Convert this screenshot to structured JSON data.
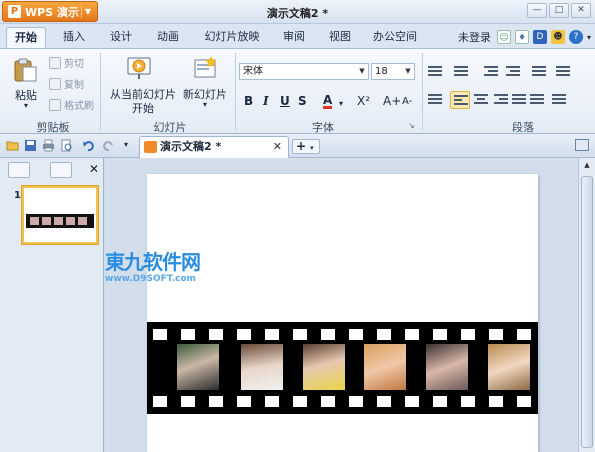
{
  "app": {
    "button_label": "WPS 演示",
    "logo_glyph": "P"
  },
  "window": {
    "title": "演示文稿2 *"
  },
  "menu": {
    "tabs": [
      "开始",
      "插入",
      "设计",
      "动画",
      "幻灯片放映",
      "审阅",
      "视图",
      "办公空间"
    ],
    "active": "开始",
    "login_label": "未登录"
  },
  "ribbon": {
    "clipboard": {
      "paste": "粘贴",
      "cut": "剪切",
      "copy": "复制",
      "format_painter": "格式刷",
      "group": "剪贴板"
    },
    "slides": {
      "from_current_line1": "从当前幻灯片",
      "from_current_line2": "开始",
      "new_slide": "新幻灯片",
      "group": "幻灯片"
    },
    "font": {
      "family": "宋体",
      "size": "18",
      "group": "字体",
      "bold": "B",
      "italic": "I",
      "underline": "U",
      "strike": "S",
      "color": "A",
      "super": "X²",
      "grow": "A+",
      "shrink": "A-"
    },
    "paragraph": {
      "group": "段落"
    }
  },
  "document_tab": {
    "label": "演示文稿2 *"
  },
  "left_panel": {
    "slide_number": "1"
  },
  "watermark": {
    "line1": "東九软件网",
    "line2": "www.D9SOFT.com"
  },
  "colors": {
    "accent_orange": "#e5771b",
    "ribbon_bg": "#e4ecf6",
    "workspace": "#d2deec"
  }
}
